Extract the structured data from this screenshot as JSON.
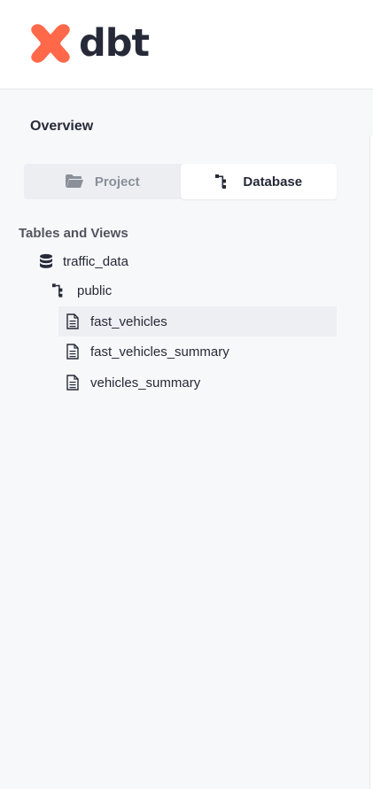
{
  "brand": {
    "name": "dbt",
    "accent": "#ff694a"
  },
  "sidebar": {
    "title": "Overview",
    "switch": {
      "project_label": "Project",
      "database_label": "Database",
      "active": "Database"
    },
    "section_label": "Tables and Views",
    "tree": {
      "database": {
        "label": "traffic_data",
        "icon": "database-icon"
      },
      "schema": {
        "label": "public",
        "icon": "schema-tree-icon"
      },
      "tables": [
        {
          "label": "fast_vehicles",
          "icon": "document-icon",
          "selected": true
        },
        {
          "label": "fast_vehicles_summary",
          "icon": "document-icon",
          "selected": false
        },
        {
          "label": "vehicles_summary",
          "icon": "document-icon",
          "selected": false
        }
      ]
    }
  }
}
